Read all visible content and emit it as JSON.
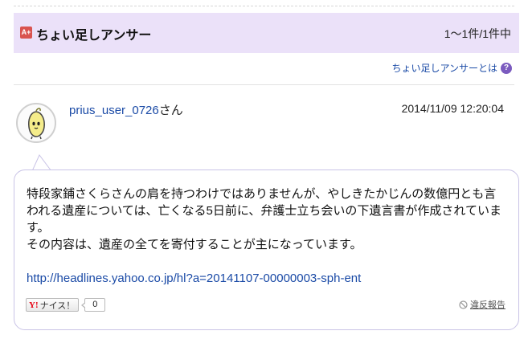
{
  "section": {
    "icon": "chotto-tashi-answer-icon",
    "title": "ちょい足しアンサー",
    "count": "1〜1件/1件中"
  },
  "help": {
    "label": "ちょい足しアンサーとは",
    "icon": "question-circle-icon"
  },
  "answer": {
    "username": "prius_user_0726",
    "honorific": "さん",
    "timestamp": "2014/11/09  12:20:04",
    "body_line1": "特段家鋪さくらさんの肩を持つわけではありませんが、やしきたかじんの数億円とも言われる遺産については、亡くなる5日前に、弁護士立ち会いの下遺言書が作成されています。",
    "body_line2": "その内容は、遺産の全てを寄付することが主になっています。",
    "link": "http://headlines.yahoo.co.jp/hl?a=20141107-00000003-sph-ent",
    "nice": {
      "logo": "Y!",
      "label": "ナイス！",
      "count": "0"
    },
    "report": {
      "label": "違反報告",
      "icon": "prohibited-icon"
    }
  },
  "colors": {
    "header_bg": "#ebe1f9",
    "link": "#1a4aa6",
    "bubble_border": "#c9c3e6",
    "help_icon": "#7b5bbf"
  }
}
